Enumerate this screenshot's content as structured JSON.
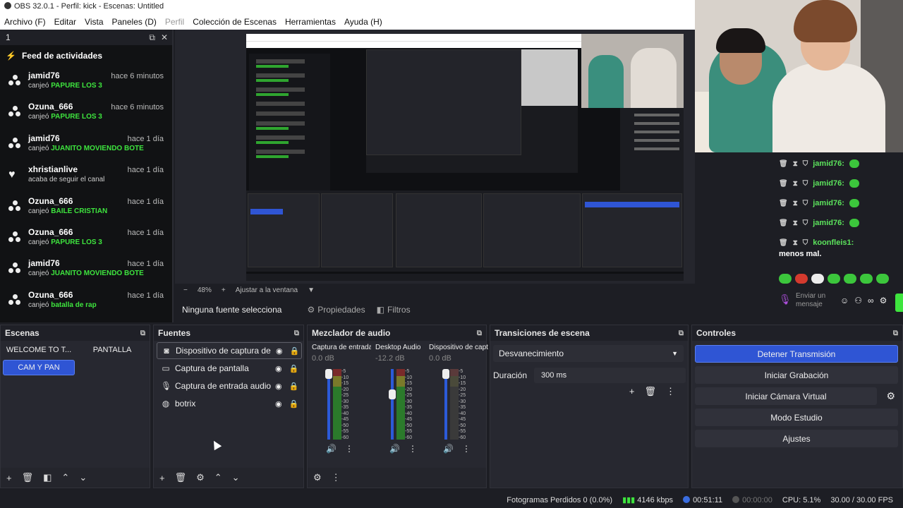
{
  "window": {
    "title": "OBS 32.0.1 - Perfil: kick - Escenas: Untitled"
  },
  "menu": [
    "Archivo (F)",
    "Editar",
    "Vista",
    "Paneles (D)",
    "Perfil",
    "Colección de Escenas",
    "Herramientas",
    "Ayuda (H)"
  ],
  "activity_dock": {
    "dock_name": "1",
    "title": "Feed de actividades",
    "items": [
      {
        "user": "jamid76",
        "time": "hace 6 minutos",
        "action": "canjeó",
        "reward": "PAPURE LOS 3",
        "icon": "dots-icon"
      },
      {
        "user": "Ozuna_666",
        "time": "hace 6 minutos",
        "action": "canjeó",
        "reward": "PAPURE LOS 3",
        "icon": "dots-icon"
      },
      {
        "user": "jamid76",
        "time": "hace 1 día",
        "action": "canjeó",
        "reward": "JUANITO MOVIENDO BOTE",
        "icon": "dots-icon"
      },
      {
        "user": "xhristianlive",
        "time": "hace 1 día",
        "action": "acaba de seguir el canal",
        "reward": "",
        "icon": "heart-icon"
      },
      {
        "user": "Ozuna_666",
        "time": "hace 1 día",
        "action": "canjeó",
        "reward": "BAILE CRISTIAN",
        "icon": "dots-icon"
      },
      {
        "user": "Ozuna_666",
        "time": "hace 1 día",
        "action": "canjeó",
        "reward": "PAPURE LOS 3",
        "icon": "dots-icon"
      },
      {
        "user": "jamid76",
        "time": "hace 1 día",
        "action": "canjeó",
        "reward": "JUANITO MOVIENDO BOTE",
        "icon": "dots-icon"
      },
      {
        "user": "Ozuna_666",
        "time": "hace 1 día",
        "action": "canjeó",
        "reward": "batalla de rap",
        "icon": "dots-icon"
      }
    ]
  },
  "chat": {
    "lines": [
      {
        "user": "jamid76:",
        "text": ""
      },
      {
        "user": "jamid76:",
        "text": ""
      },
      {
        "user": "jamid76:",
        "text": ""
      },
      {
        "user": "jamid76:",
        "text": ""
      },
      {
        "user": "koonfleis1:",
        "text": "menos mal."
      }
    ],
    "input_placeholder": "Enviar un mensaje"
  },
  "zoom": {
    "percent": "48%",
    "fit_label": "Ajustar a la ventana"
  },
  "source_bar": {
    "none_selected": "Ninguna fuente selecciona",
    "properties": "Propiedades",
    "filters": "Filtros"
  },
  "scenes": {
    "title": "Escenas",
    "items": [
      "WELCOME TO T...",
      "PANTALLA",
      "CAM Y PAN"
    ],
    "active": "CAM Y PAN"
  },
  "sources": {
    "title": "Fuentes",
    "items": [
      {
        "name": "Dispositivo de captura de v",
        "icon": "camera-icon"
      },
      {
        "name": "Captura de pantalla",
        "icon": "monitor-icon"
      },
      {
        "name": "Captura de entrada audio",
        "icon": "microphone-icon"
      },
      {
        "name": "botrix",
        "icon": "globe-icon"
      }
    ]
  },
  "mixer": {
    "title": "Mezclador de audio",
    "channels": [
      {
        "name": "Captura de entrada",
        "db": "0.0 dB",
        "level": 1.0,
        "muted": false
      },
      {
        "name": "Desktop Audio",
        "db": "-12.2 dB",
        "level": 0.66,
        "muted": false
      },
      {
        "name": "Dispositivo de capt",
        "db": "0.0 dB",
        "level": 1.0,
        "muted": true
      }
    ],
    "ticks": [
      "-5",
      "-10",
      "-15",
      "-20",
      "-25",
      "-30",
      "-35",
      "-40",
      "-45",
      "-50",
      "-55",
      "-60"
    ]
  },
  "transitions": {
    "title": "Transiciones de escena",
    "selected": "Desvanecimiento",
    "duration_label": "Duración",
    "duration_value": "300 ms"
  },
  "controls": {
    "title": "Controles",
    "buttons": [
      "Detener Transmisión",
      "Iniciar Grabación",
      "Iniciar Cámara Virtual",
      "Modo Estudio",
      "Ajustes"
    ]
  },
  "status": {
    "dropped": "Fotogramas Perdidos 0 (0.0%)",
    "bitrate": "4146 kbps",
    "live_time": "00:51:11",
    "rec_time": "00:00:00",
    "cpu": "CPU: 5.1%",
    "fps": "30.00 / 30.00 FPS"
  },
  "colors": {
    "accent": "#2f55d4",
    "reward": "#3ee53e",
    "panel": "#272830"
  }
}
